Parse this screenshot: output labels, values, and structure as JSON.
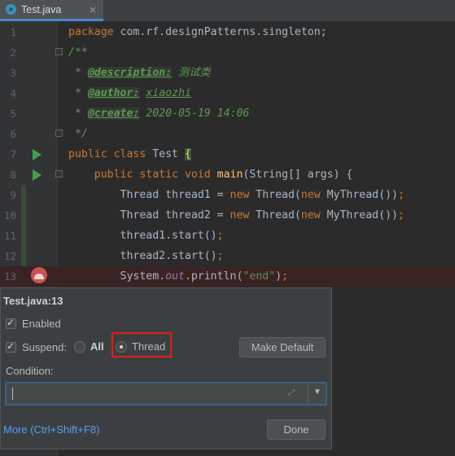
{
  "tab": {
    "filename": "Test.java",
    "close": "×"
  },
  "code_lines": [
    {
      "num": "1",
      "html": "<span class=\"kw\">package </span>com.rf.designPatterns.singleton;"
    },
    {
      "num": "2",
      "html": "<span class=\"cm\">/**</span>"
    },
    {
      "num": "3",
      "html": "<span class=\"cm\"> * </span><span class=\"tag\">@description:</span><span class=\"cm\"> 测试类</span>"
    },
    {
      "num": "4",
      "html": "<span class=\"cm\"> * </span><span class=\"tag\">@author:</span><span class=\"cm\"> </span><span class=\"tagv\">xiaozhi</span>"
    },
    {
      "num": "5",
      "html": "<span class=\"cm\"> * </span><span class=\"tag\">@create:</span><span class=\"cm\"> 2020-05-19 14:06</span>"
    },
    {
      "num": "6",
      "html": "<span class=\"cm\"> */</span>"
    },
    {
      "num": "7",
      "html": "<span class=\"kw\">public class </span>Test <span class=\"brace\">{</span>"
    },
    {
      "num": "8",
      "html": "    <span class=\"kw\">public static void </span><span class=\"fn\">main</span>(String[] args) {"
    },
    {
      "num": "9",
      "html": "        Thread thread1 = <span class=\"kw\">new </span>Thread(<span class=\"kw\">new </span>MyThread())<span class=\"kw\">;</span>"
    },
    {
      "num": "10",
      "html": "        Thread thread2 = <span class=\"kw\">new </span>Thread(<span class=\"kw\">new </span>MyThread())<span class=\"kw\">;</span>"
    },
    {
      "num": "11",
      "html": "        thread1.start()<span class=\"kw\">;</span>"
    },
    {
      "num": "12",
      "html": "        thread2.start()<span class=\"kw\">;</span>"
    },
    {
      "num": "13",
      "html": "        System.<span class=\"fld\">out</span>.println(<span class=\"str\">\"end\"</span>)<span class=\"kw\">;</span>"
    }
  ],
  "popup": {
    "title": "Test.java:13",
    "enabled_label": "Enabled",
    "suspend_label": "Suspend:",
    "all_label": "All",
    "thread_label": "Thread",
    "suspend_selected": "Thread",
    "make_default_label": "Make Default",
    "condition_label": "Condition:",
    "condition_value": "",
    "more_label": "More (Ctrl+Shift+F8)",
    "done_label": "Done"
  },
  "colors": {
    "accent": "#4a88c7",
    "breakpoint": "#c75450",
    "highlight_box": "#e51c1c",
    "link": "#589df6"
  }
}
